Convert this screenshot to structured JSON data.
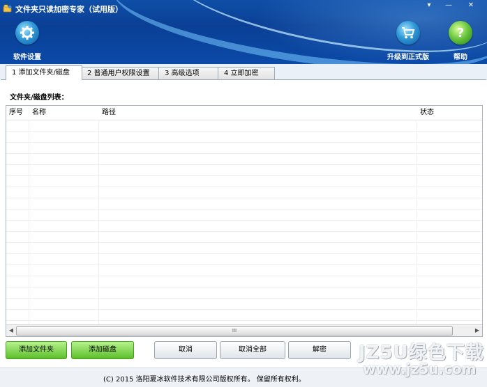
{
  "window": {
    "title": "文件夹只读加密专家（试用版）",
    "controls": {
      "dropdown": "▾",
      "minimize": "—",
      "restore": "□",
      "close": "✕"
    }
  },
  "toolbar": {
    "settings_label": "软件设置",
    "upgrade_label": "升级到正式版",
    "help_label": "帮助"
  },
  "tabs": [
    {
      "label": "1 添加文件夹/磁盘",
      "active": true
    },
    {
      "label": "2 普通用户权限设置",
      "active": false
    },
    {
      "label": "3 高级选项",
      "active": false
    },
    {
      "label": "4 立即加密",
      "active": false
    }
  ],
  "list": {
    "title": "文件夹/磁盘列表：",
    "columns": [
      "序号",
      "名称",
      "路径",
      "状态"
    ],
    "rows": [],
    "scroll_thumb": "III"
  },
  "buttons": {
    "add_folder": "添加文件夹",
    "add_disk": "添加磁盘",
    "cancel": "取消",
    "cancel_all": "取消全部",
    "decrypt": "解密"
  },
  "footer": {
    "copyright": "(C)  2015 洛阳夏冰软件技术有限公司版权所有。 保留所有权利。"
  },
  "watermark": {
    "line1": "JZ5U绿色下载",
    "line2": "www.jz5u.com"
  },
  "colors": {
    "header_blue": "#0b4aa8",
    "green_button": "#5cc02a"
  }
}
